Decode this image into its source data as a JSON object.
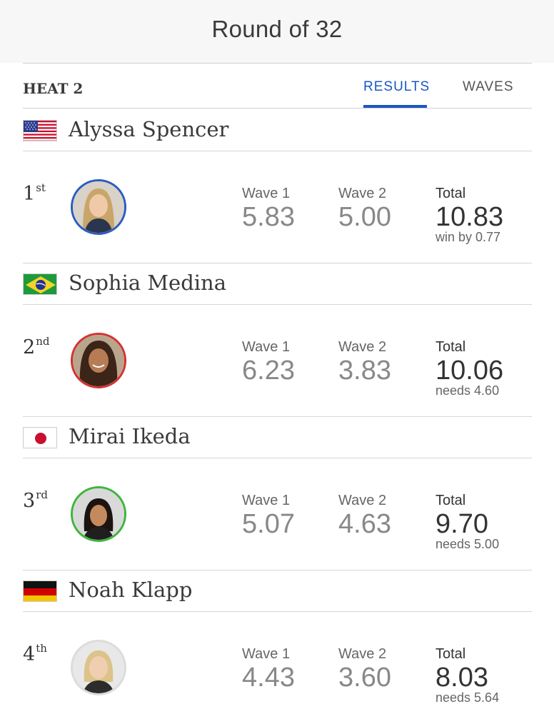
{
  "header": {
    "title": "Round of 32"
  },
  "heat": {
    "label": "HEAT 2",
    "tabs": [
      {
        "label": "RESULTS",
        "active": true
      },
      {
        "label": "WAVES",
        "active": false
      }
    ]
  },
  "colors": {
    "accent": "#1a56c4",
    "rank1": "#2b5cc0",
    "rank2": "#d33232",
    "rank3": "#3db53d",
    "rank4": "#dcdcdc"
  },
  "labels": {
    "wave1": "Wave 1",
    "wave2": "Wave 2",
    "total": "Total"
  },
  "athletes": [
    {
      "name": "Alyssa Spencer",
      "flag": "usa-flag",
      "rank_num": "1",
      "rank_suffix": "st",
      "wave1": "5.83",
      "wave2": "5.00",
      "total": "10.83",
      "note": "win by 0.77"
    },
    {
      "name": "Sophia Medina",
      "flag": "brazil-flag",
      "rank_num": "2",
      "rank_suffix": "nd",
      "wave1": "6.23",
      "wave2": "3.83",
      "total": "10.06",
      "note": "needs 4.60"
    },
    {
      "name": "Mirai Ikeda",
      "flag": "japan-flag",
      "rank_num": "3",
      "rank_suffix": "rd",
      "wave1": "5.07",
      "wave2": "4.63",
      "total": "9.70",
      "note": "needs 5.00"
    },
    {
      "name": "Noah Klapp",
      "flag": "germany-flag",
      "rank_num": "4",
      "rank_suffix": "th",
      "wave1": "4.43",
      "wave2": "3.60",
      "total": "8.03",
      "note": "needs 5.64"
    }
  ]
}
